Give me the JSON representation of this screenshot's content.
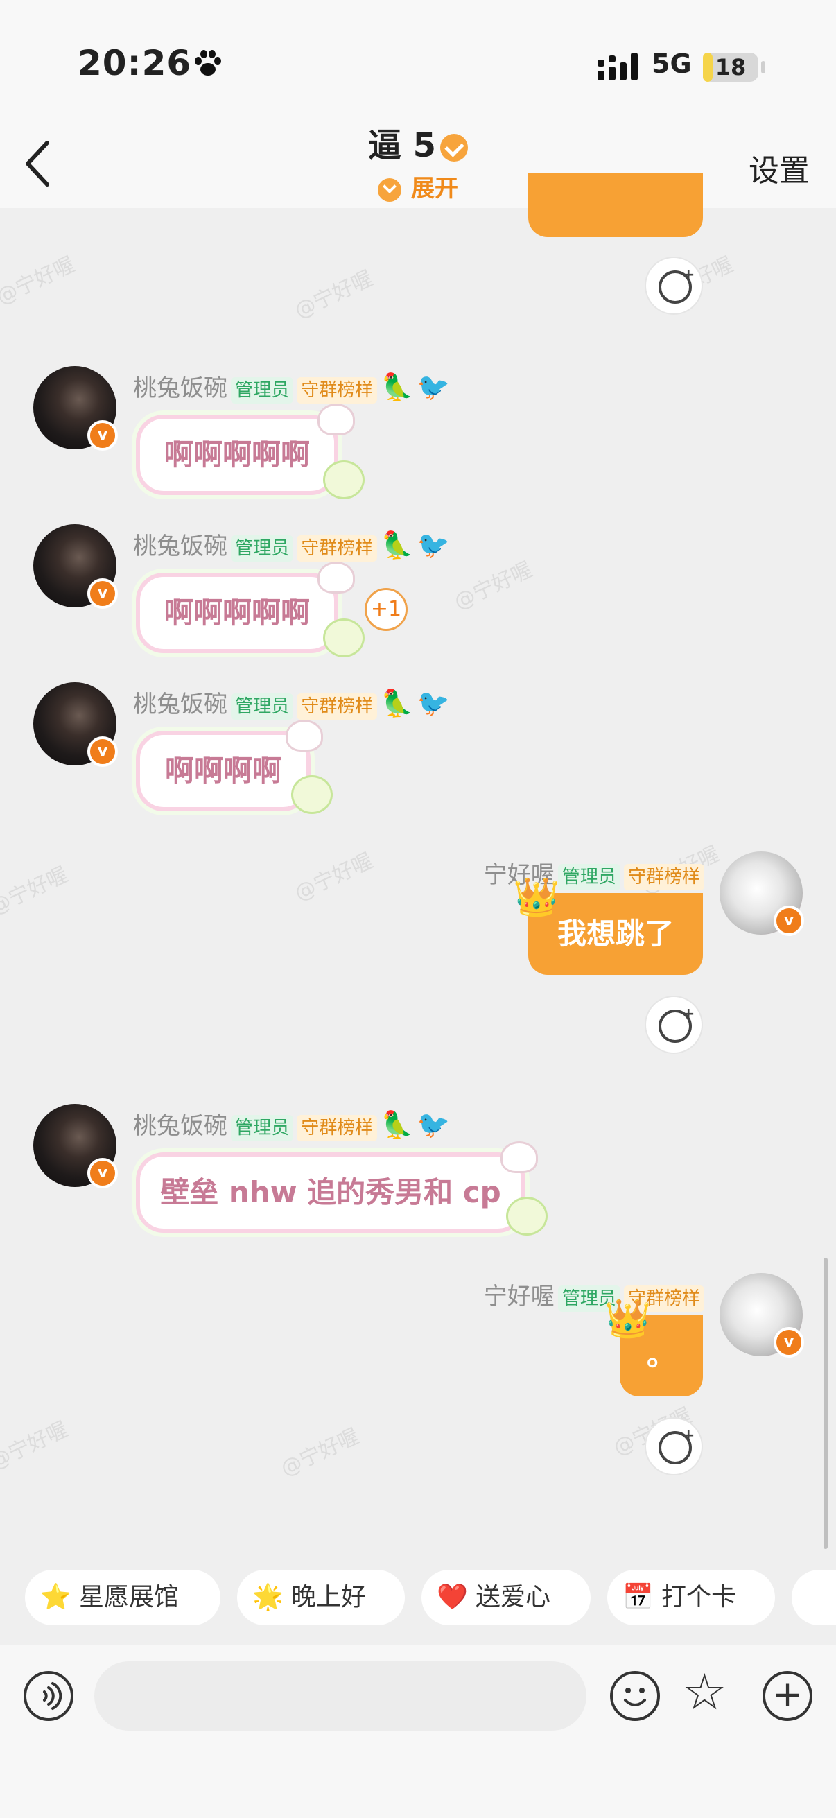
{
  "status_bar": {
    "time": "20:26",
    "network": "5G",
    "battery": "18",
    "battery_level": 0.18
  },
  "nav": {
    "title": "逼 5",
    "expand_label": "展开",
    "settings_label": "设置"
  },
  "tags": {
    "admin": "管理员",
    "guard": "守群榜样"
  },
  "messages": [
    {
      "side": "left",
      "user": "桃兔饭碗",
      "text": "啊啊啊啊啊"
    },
    {
      "side": "left",
      "user": "桃兔饭碗",
      "text": "啊啊啊啊啊",
      "counter": "+1"
    },
    {
      "side": "left",
      "user": "桃兔饭碗",
      "text": "啊啊啊啊"
    },
    {
      "side": "right",
      "user": "宁好喔",
      "text": "我想跳了"
    },
    {
      "side": "left",
      "user": "桃兔饭碗",
      "text": "壁垒 nhw 追的秀男和 cp"
    },
    {
      "side": "right",
      "user": "宁好喔",
      "text": "。"
    }
  ],
  "watermark": "@宁好喔",
  "quick_replies": [
    {
      "label": "星愿展馆",
      "icon": "star-icon"
    },
    {
      "label": "晚上好",
      "icon": "star-face-icon"
    },
    {
      "label": "送爱心",
      "icon": "heart-icon"
    },
    {
      "label": "打个卡",
      "icon": "calendar-icon"
    }
  ],
  "colors": {
    "accent": "#f7a134",
    "admin_tag": "#2fa763",
    "guard_tag": "#e08b1a",
    "bubble_text": "#c77a95"
  }
}
